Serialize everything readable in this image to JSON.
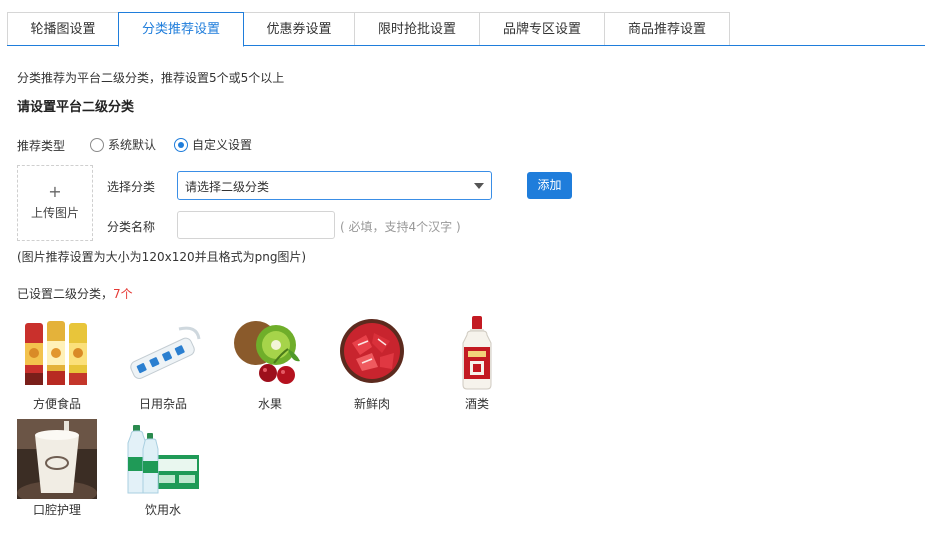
{
  "tabs": [
    {
      "label": "轮播图设置",
      "active": false
    },
    {
      "label": "分类推荐设置",
      "active": true
    },
    {
      "label": "优惠券设置",
      "active": false
    },
    {
      "label": "限时抢批设置",
      "active": false
    },
    {
      "label": "品牌专区设置",
      "active": false
    },
    {
      "label": "商品推荐设置",
      "active": false
    }
  ],
  "intro": {
    "tip": "分类推荐为平台二级分类，推荐设置5个或5个以上",
    "heading": "请设置平台二级分类"
  },
  "form": {
    "type_label": "推荐类型",
    "radio_default": "系统默认",
    "radio_custom": "自定义设置",
    "selected_radio": "自定义设置",
    "upload_plus": "+",
    "upload_label": "上传图片",
    "category_label": "选择分类",
    "category_value": "请选择二级分类",
    "add_button": "添加",
    "name_label": "分类名称",
    "name_value": "",
    "name_hint": "( 必填，支持4个汉字 )",
    "image_note": "(图片推荐设置为大小为120x120并且格式为png图片)"
  },
  "list": {
    "count_prefix": "已设置二级分类，",
    "count": "7个",
    "items": [
      {
        "label": "方便食品",
        "icon": "snack-cans-image"
      },
      {
        "label": "日用杂品",
        "icon": "power-strip-image"
      },
      {
        "label": "水果",
        "icon": "kiwi-cherry-image"
      },
      {
        "label": "新鲜肉",
        "icon": "meat-plate-image"
      },
      {
        "label": "酒类",
        "icon": "liquor-bottle-image"
      },
      {
        "label": "口腔护理",
        "icon": "coffee-cup-image"
      },
      {
        "label": "饮用水",
        "icon": "water-bottles-image"
      }
    ]
  },
  "colors": {
    "accent": "#1f7ddb",
    "count_red": "#e53935",
    "hint_gray": "#999999"
  }
}
